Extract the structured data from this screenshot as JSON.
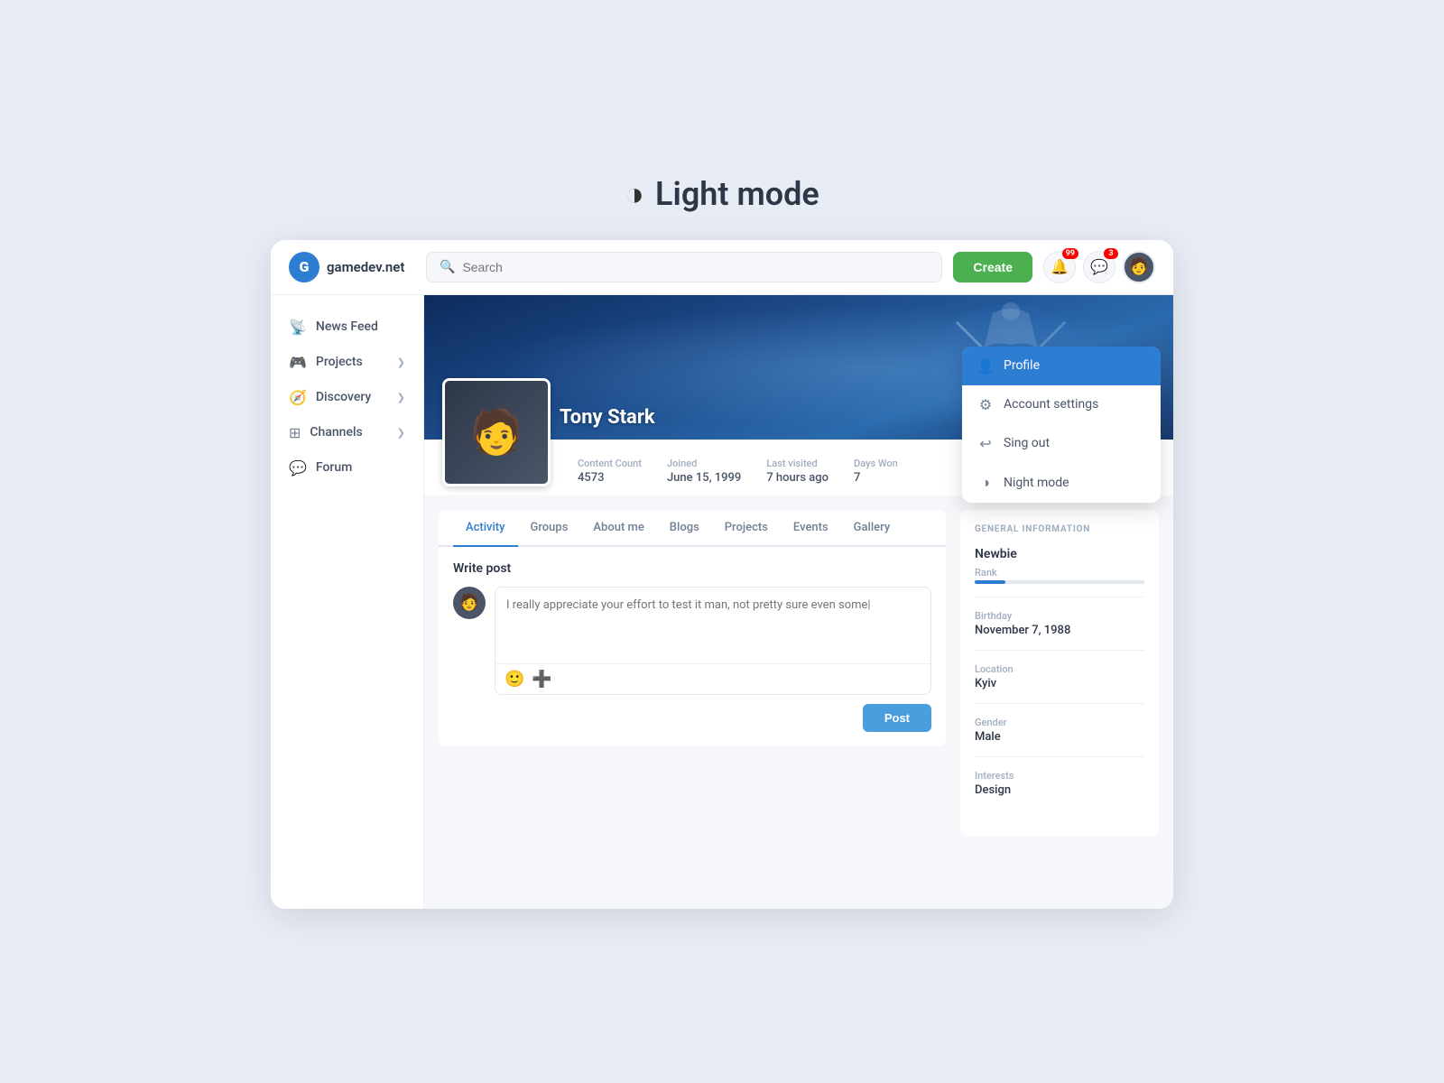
{
  "page": {
    "title": "Light mode",
    "mode_icon": "◑"
  },
  "topbar": {
    "logo_text": "gamedev.net",
    "logo_letter": "G",
    "search_placeholder": "Search",
    "create_label": "Create",
    "notif1_count": "99",
    "notif2_count": "3"
  },
  "sidebar": {
    "items": [
      {
        "id": "news-feed",
        "label": "News Feed",
        "icon": "📡",
        "has_chevron": false
      },
      {
        "id": "projects",
        "label": "Projects",
        "icon": "🎮",
        "has_chevron": true
      },
      {
        "id": "discovery",
        "label": "Discovery",
        "icon": "🧭",
        "has_chevron": true
      },
      {
        "id": "channels",
        "label": "Channels",
        "icon": "⊞",
        "has_chevron": true
      },
      {
        "id": "forum",
        "label": "Forum",
        "icon": "💬",
        "has_chevron": false
      }
    ]
  },
  "profile": {
    "name": "Tony Stark",
    "stats": [
      {
        "label": "Content Count",
        "value": "4573"
      },
      {
        "label": "Joined",
        "value": "June 15, 1999"
      },
      {
        "label": "Last visited",
        "value": "7 hours ago"
      },
      {
        "label": "Days Won",
        "value": "7"
      }
    ]
  },
  "tabs": [
    {
      "id": "activity",
      "label": "Activity",
      "active": true
    },
    {
      "id": "groups",
      "label": "Groups",
      "active": false
    },
    {
      "id": "about-me",
      "label": "About me",
      "active": false
    },
    {
      "id": "blogs",
      "label": "Blogs",
      "active": false
    },
    {
      "id": "projects",
      "label": "Projects",
      "active": false
    },
    {
      "id": "events",
      "label": "Events",
      "active": false
    },
    {
      "id": "gallery",
      "label": "Gallery",
      "active": false
    }
  ],
  "write_post": {
    "title": "Write post",
    "placeholder": "I really appreciate your effort to test it man, not pretty sure even some|",
    "post_button": "Post"
  },
  "general_info": {
    "title": "GENERAL INFORMATION",
    "rank_label": "Newbie",
    "rank_sub": "Rank",
    "rank_percent": 18,
    "items": [
      {
        "label": "Birthday",
        "value": "November 7, 1988"
      },
      {
        "label": "Location",
        "value": "Kyiv"
      },
      {
        "label": "Gender",
        "value": "Male"
      },
      {
        "label": "Interests",
        "value": "Design"
      }
    ]
  },
  "dropdown": {
    "items": [
      {
        "id": "profile",
        "label": "Profile",
        "icon": "👤",
        "active": true
      },
      {
        "id": "account-settings",
        "label": "Account settings",
        "icon": "⚙",
        "active": false
      },
      {
        "id": "sign-out",
        "label": "Sing out",
        "icon": "↩",
        "active": false
      },
      {
        "id": "night-mode",
        "label": "Night mode",
        "icon": "◑",
        "active": false
      }
    ]
  }
}
